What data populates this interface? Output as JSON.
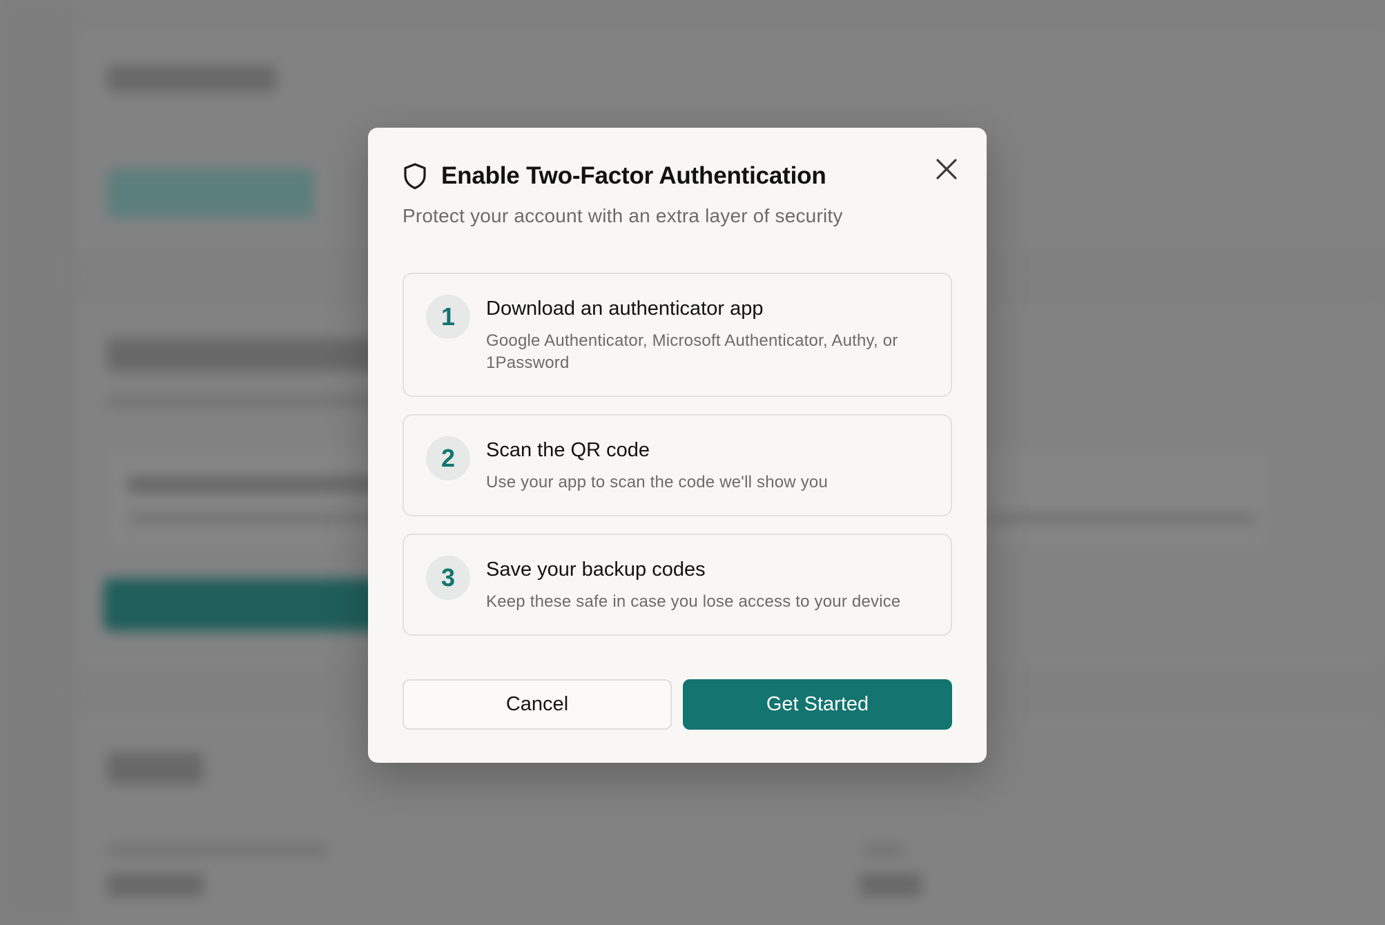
{
  "modal": {
    "title": "Enable Two-Factor Authentication",
    "subtitle": "Protect your account with an extra layer of security",
    "icon": "shield-icon",
    "close_icon": "close-icon",
    "steps": [
      {
        "number": "1",
        "title": "Download an authenticator app",
        "description": "Google Authenticator, Microsoft Authenticator, Authy, or 1Password"
      },
      {
        "number": "2",
        "title": "Scan the QR code",
        "description": "Use your app to scan the code we'll show you"
      },
      {
        "number": "3",
        "title": "Save your backup codes",
        "description": "Keep these safe in case you lose access to your device"
      }
    ],
    "cancel_label": "Cancel",
    "primary_label": "Get Started"
  },
  "colors": {
    "accent": "#137470",
    "overlay": "#808080",
    "modal_background": "#f8f7f5",
    "step_badge_background": "#e6e9e7"
  }
}
